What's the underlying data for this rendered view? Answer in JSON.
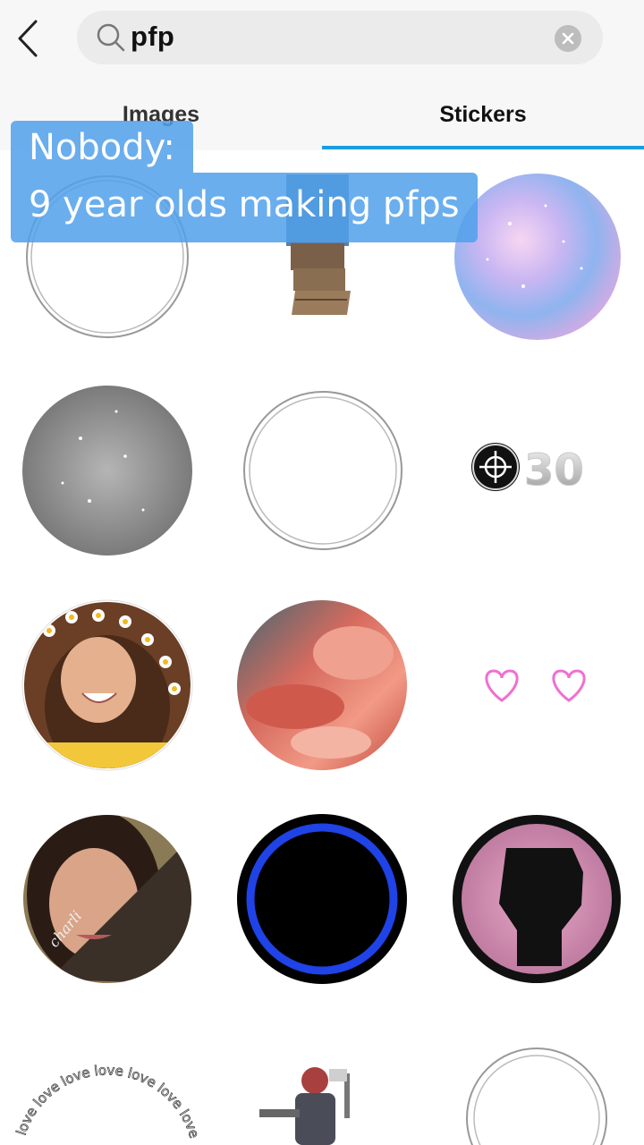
{
  "search": {
    "query": "pfp"
  },
  "tabs": [
    {
      "label": "Images",
      "active": false
    },
    {
      "label": "Stickers",
      "active": true
    }
  ],
  "caption": {
    "line1": "Nobody:",
    "line2": "9 year olds making pfps"
  },
  "stickers": [
    {
      "name": "outline-ring"
    },
    {
      "name": "wooden-structure"
    },
    {
      "name": "galaxy-circle"
    },
    {
      "name": "silver-glitter-circle"
    },
    {
      "name": "thin-ring"
    },
    {
      "name": "crosshair-30-badge",
      "text": "30"
    },
    {
      "name": "daisy-crown-portrait"
    },
    {
      "name": "pink-clouds-circle"
    },
    {
      "name": "twin-pink-hearts"
    },
    {
      "name": "portrait-with-name",
      "text": "charli"
    },
    {
      "name": "blue-ring-black-circle"
    },
    {
      "name": "raised-fist-pink-glitter"
    },
    {
      "name": "love-text-ring",
      "text": "love love love love love love love love love love"
    },
    {
      "name": "game-character"
    },
    {
      "name": "double-ring"
    }
  ],
  "colors": {
    "accent": "#1a9de0",
    "caption_bg": "#50a0eb"
  }
}
